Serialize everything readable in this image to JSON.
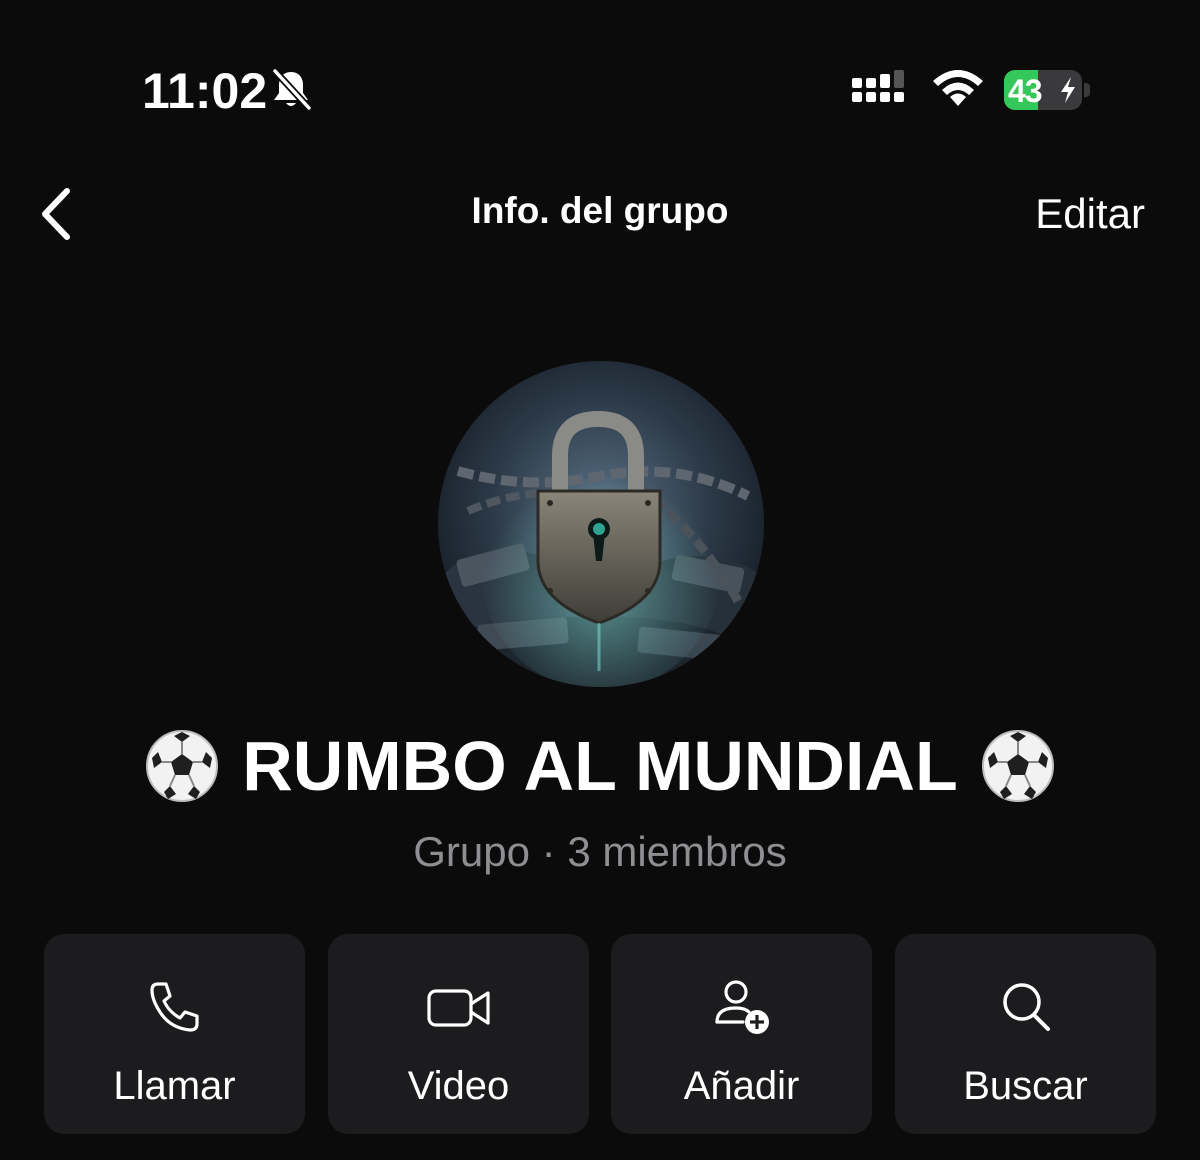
{
  "status_bar": {
    "time": "11:02",
    "battery_level": "43",
    "battery_fraction": 0.43,
    "battery_color": "#34c759",
    "icons": [
      "bell-slash-icon",
      "cellular-signal-icon",
      "wifi-icon",
      "battery-icon",
      "charging-bolt-icon"
    ]
  },
  "nav": {
    "back_icon": "chevron-left-icon",
    "title": "Info. del grupo",
    "edit_label": "Editar"
  },
  "group": {
    "avatar": "group-avatar-padlock-image",
    "name": "RUMBO AL MUNDIAL",
    "name_prefix_emoji": "soccer-ball-icon",
    "name_suffix_emoji": "soccer-ball-icon",
    "subtitle": "Grupo · 3 miembros"
  },
  "actions": [
    {
      "label": "Llamar",
      "icon": "phone-icon"
    },
    {
      "label": "Video",
      "icon": "video-camera-icon"
    },
    {
      "label": "Añadir",
      "icon": "add-person-icon"
    },
    {
      "label": "Buscar",
      "icon": "search-icon"
    }
  ]
}
